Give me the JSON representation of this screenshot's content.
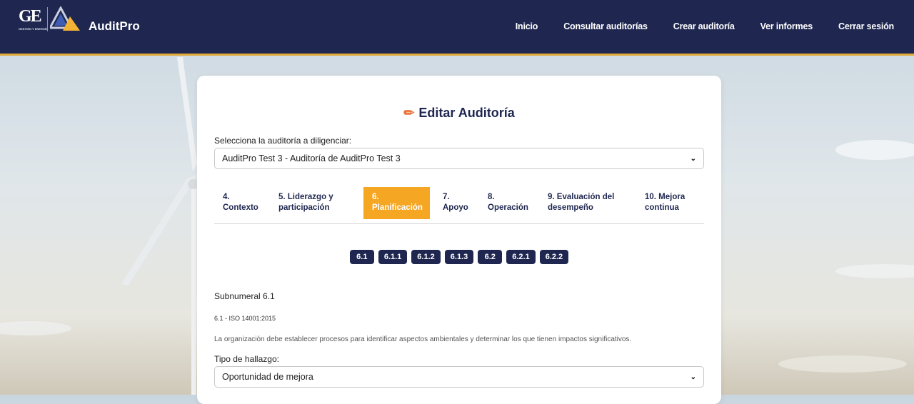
{
  "app": {
    "brand": "AuditPro",
    "logo_text": "GE",
    "logo_caption": "GESTIÓN Y ENERGÍA"
  },
  "nav": [
    "Inicio",
    "Consultar auditorías",
    "Crear auditoría",
    "Ver informes",
    "Cerrar sesión"
  ],
  "page": {
    "title": "Editar Auditoría",
    "select_label": "Selecciona la auditoría a diligenciar:",
    "selected_audit": "AuditPro Test 3 - Auditoría de AuditPro Test 3"
  },
  "tabs": [
    {
      "line1": "4.",
      "line2": "Contexto"
    },
    {
      "line1": "5. Liderazgo y",
      "line2": "participación"
    },
    {
      "line1": "6.",
      "line2": "Planificación"
    },
    {
      "line1": "7.",
      "line2": "Apoyo"
    },
    {
      "line1": "8.",
      "line2": "Operación"
    },
    {
      "line1": "9. Evaluación del",
      "line2": "desempeño"
    },
    {
      "line1": "10. Mejora",
      "line2": "continua"
    }
  ],
  "subnumerals": [
    "6.1",
    "6.1.1",
    "6.1.2",
    "6.1.3",
    "6.2",
    "6.2.1",
    "6.2.2"
  ],
  "section": {
    "subtitle": "Subnumeral 6.1",
    "iso": "6.1 - ISO 14001:2015",
    "description": "La organización debe establecer procesos para identificar aspectos ambientales y determinar los que tienen impactos significativos.",
    "finding_label": "Tipo de hallazgo:",
    "finding_value": "Oportunidad de mejora"
  },
  "colors": {
    "navy": "#1f2750",
    "accent": "#f5a623",
    "pencil": "#e8743b"
  }
}
